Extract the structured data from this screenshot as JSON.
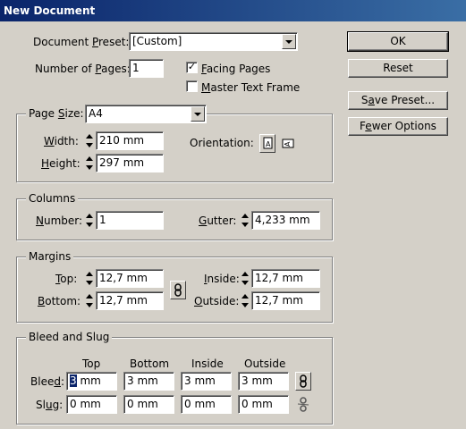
{
  "window": {
    "title": "New Document"
  },
  "document_preset": {
    "label": "Document Preset:",
    "value": "[Custom]"
  },
  "number_of_pages": {
    "label": "Number of Pages:",
    "value": "1"
  },
  "facing_pages": {
    "label": "Facing Pages",
    "checked": true
  },
  "master_text_frame": {
    "label": "Master Text Frame",
    "checked": false
  },
  "buttons": {
    "ok": "OK",
    "reset": "Reset",
    "save_preset": "Save Preset...",
    "fewer_options": "Fewer Options"
  },
  "page_size": {
    "label": "Page Size:",
    "value": "A4",
    "width_label": "Width:",
    "width": "210 mm",
    "height_label": "Height:",
    "height": "297 mm",
    "orientation_label": "Orientation:"
  },
  "columns": {
    "title": "Columns",
    "number_label": "Number:",
    "number": "1",
    "gutter_label": "Gutter:",
    "gutter": "4,233 mm"
  },
  "margins": {
    "title": "Margins",
    "top_label": "Top:",
    "top": "12,7 mm",
    "bottom_label": "Bottom:",
    "bottom": "12,7 mm",
    "inside_label": "Inside:",
    "inside": "12,7 mm",
    "outside_label": "Outside:",
    "outside": "12,7 mm"
  },
  "bleed_slug": {
    "title": "Bleed and Slug",
    "headers": [
      "Top",
      "Bottom",
      "Inside",
      "Outside"
    ],
    "bleed_label": "Bleed:",
    "bleed": [
      "3 mm",
      "3 mm",
      "3 mm",
      "3 mm"
    ],
    "slug_label": "Slug:",
    "slug": [
      "0 mm",
      "0 mm",
      "0 mm",
      "0 mm"
    ]
  },
  "icons": {
    "portrait": "portrait-orientation-icon",
    "landscape": "landscape-orientation-icon",
    "link": "chain-link-icon"
  }
}
